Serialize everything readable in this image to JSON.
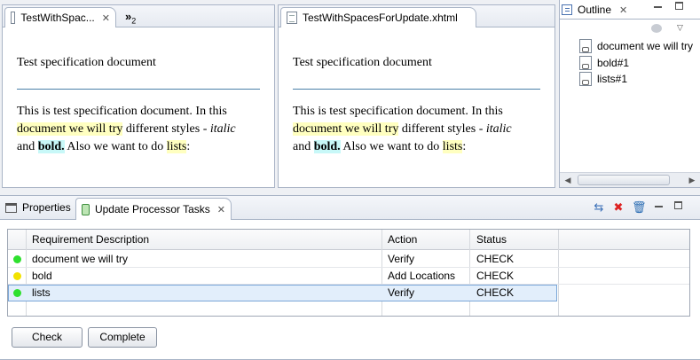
{
  "editor_left": {
    "tab_label": "TestWithSpac...",
    "overflow_label": "»",
    "overflow_count": "2",
    "doc": {
      "title": "Test specification document",
      "p_1": "This is test specification document. In this",
      "p_hl_1": "document we will try",
      "p_2": " different styles - ",
      "p_italic": "italic",
      "p_3": "and ",
      "p_bold": "bold.",
      "p_4": " Also we want to do ",
      "p_hl_2": "lists",
      "p_5": ":"
    }
  },
  "editor_right": {
    "tab_label": "TestWithSpacesForUpdate.xhtml",
    "doc": {
      "title": "Test specification document",
      "p_1": "This is test specification document. In this",
      "p_hl_1": "document we will try",
      "p_2": " different styles - ",
      "p_italic": "italic",
      "p_3": "and ",
      "p_bold": "bold.",
      "p_4": " Also we want to do ",
      "p_hl_2": "lists",
      "p_5": ":"
    }
  },
  "outline": {
    "tab_label": "Outline",
    "items": [
      "document we will try",
      "bold#1",
      "lists#1"
    ]
  },
  "bottom_panel": {
    "tabs": {
      "properties": "Properties",
      "tasks": "Update Processor Tasks"
    },
    "columns": [
      "Requirement Description",
      "Action",
      "Status"
    ],
    "rows": [
      {
        "description": "document we will try",
        "action": "Verify",
        "status": "CHECK",
        "color": "#2ee02e"
      },
      {
        "description": "bold",
        "action": "Add Locations",
        "status": "CHECK",
        "color": "#f2e200"
      },
      {
        "description": "lists",
        "action": "Verify",
        "status": "CHECK",
        "color": "#2ee02e"
      }
    ],
    "buttons": {
      "check": "Check",
      "complete": "Complete"
    }
  }
}
